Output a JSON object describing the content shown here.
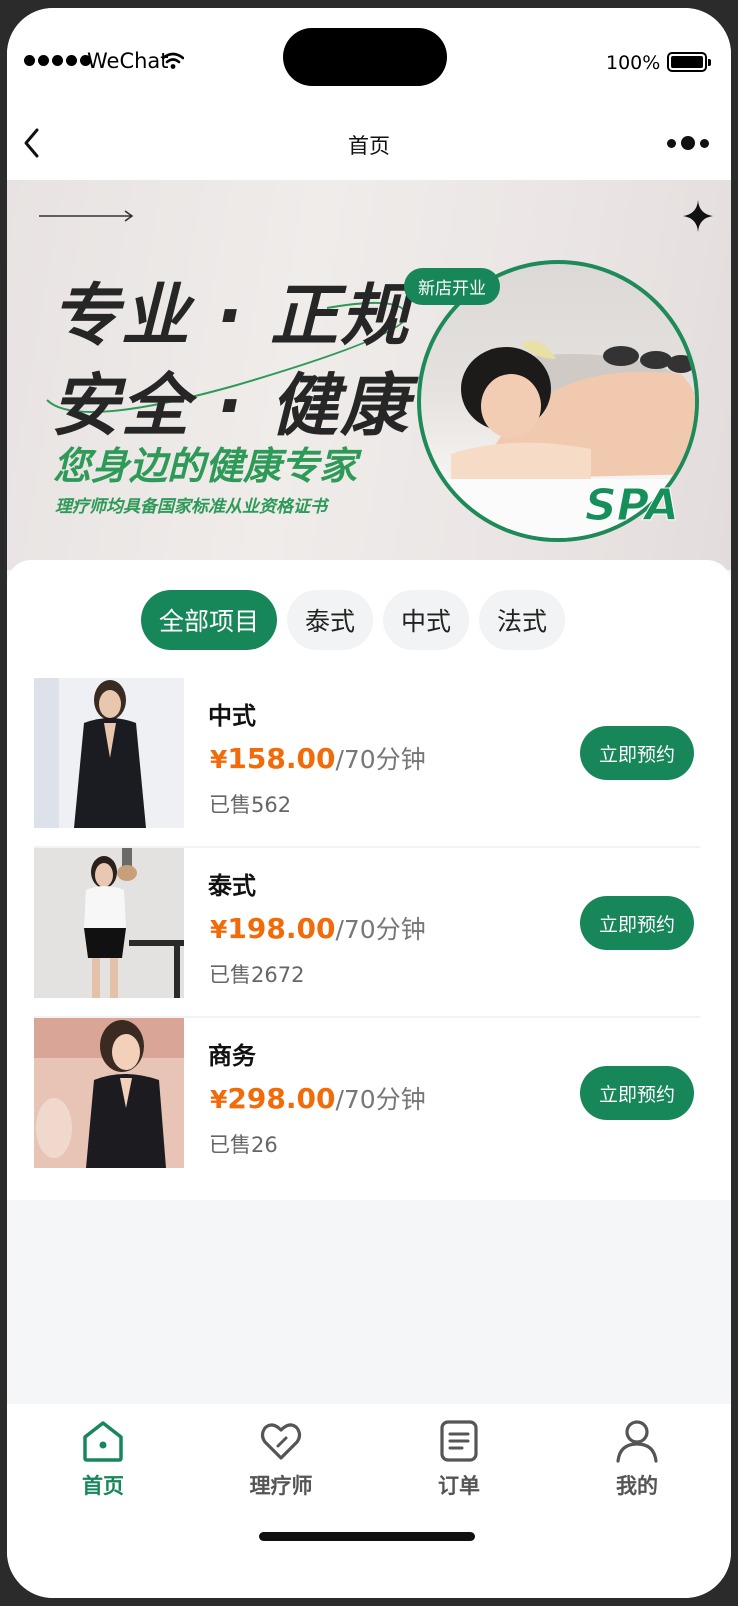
{
  "status_bar": {
    "carrier": "WeChat",
    "battery": "100%"
  },
  "navbar": {
    "title": "首页"
  },
  "banner": {
    "headline_1": "专业 · 正规",
    "headline_2": "安全 · 健康",
    "tagline": "您身边的健康专家",
    "subtag": "理疗师均具备国家标准从业资格证书",
    "badge": "新店开业",
    "spa_logo": "SPA"
  },
  "tabs": [
    {
      "label": "全部项目",
      "active": true
    },
    {
      "label": "泰式",
      "active": false
    },
    {
      "label": "中式",
      "active": false
    },
    {
      "label": "法式",
      "active": false
    }
  ],
  "products": [
    {
      "name": "中式",
      "currency": "¥",
      "price": "158.00",
      "duration": "/70分钟",
      "sold": "已售562",
      "action": "立即预约"
    },
    {
      "name": "泰式",
      "currency": "¥",
      "price": "198.00",
      "duration": "/70分钟",
      "sold": "已售2672",
      "action": "立即预约"
    },
    {
      "name": "商务",
      "currency": "¥",
      "price": "298.00",
      "duration": "/70分钟",
      "sold": "已售26",
      "action": "立即预约"
    }
  ],
  "tabbar": [
    {
      "label": "首页",
      "icon": "home-icon",
      "active": true
    },
    {
      "label": "理疗师",
      "icon": "heart-icon",
      "active": false
    },
    {
      "label": "订单",
      "icon": "order-list-icon",
      "active": false
    },
    {
      "label": "我的",
      "icon": "user-icon",
      "active": false
    }
  ],
  "colors": {
    "brand": "#17875a",
    "price": "#f26b0a"
  }
}
